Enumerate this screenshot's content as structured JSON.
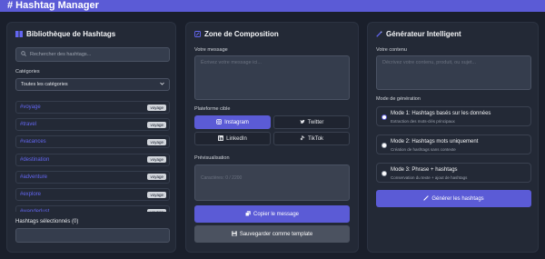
{
  "app": {
    "title": "# Hashtag Manager"
  },
  "library": {
    "title": "Bibliothèque de Hashtags",
    "search_placeholder": "Rechercher des hashtags...",
    "categories_label": "Catégories",
    "category_selected": "Toutes les catégories",
    "hashtags": [
      {
        "tag": "#voyage",
        "category": "voyage"
      },
      {
        "tag": "#travel",
        "category": "voyage"
      },
      {
        "tag": "#vacances",
        "category": "voyage"
      },
      {
        "tag": "#destination",
        "category": "voyage"
      },
      {
        "tag": "#adventure",
        "category": "voyage"
      },
      {
        "tag": "#explore",
        "category": "voyage"
      },
      {
        "tag": "#wanderlust",
        "category": "voyage"
      }
    ],
    "selected_label": "Hashtags sélectionnés (0)"
  },
  "composition": {
    "title": "Zone de Composition",
    "message_label": "Votre message",
    "message_placeholder": "Écrivez votre message ici...",
    "platform_label": "Plateforme cible",
    "platforms": [
      {
        "label": "Instagram",
        "icon": "instagram-icon",
        "active": true
      },
      {
        "label": "Twitter",
        "icon": "twitter-icon",
        "active": false
      },
      {
        "label": "LinkedIn",
        "icon": "linkedin-icon",
        "active": false
      },
      {
        "label": "TikTok",
        "icon": "tiktok-icon",
        "active": false
      }
    ],
    "preview_label": "Prévisualisation",
    "char_count": "Caractères: 0 / 2200",
    "copy_label": "Copier le message",
    "save_label": "Sauvegarder comme template"
  },
  "generator": {
    "title": "Générateur Intelligent",
    "content_label": "Votre contenu",
    "content_placeholder": "Décrivez votre contenu, produit, ou sujet...",
    "mode_label": "Mode de génération",
    "modes": [
      {
        "title": "Mode 1: Hashtags basés sur les données",
        "desc": "Extraction des mots-clés principaux",
        "selected": true
      },
      {
        "title": "Mode 2: Hashtags mots uniquement",
        "desc": "Création de hashtags sans contexte",
        "selected": false
      },
      {
        "title": "Mode 3: Phrase + hashtags",
        "desc": "Conservation du texte + ajout de hashtags",
        "selected": false
      }
    ],
    "generate_label": "Générer les hashtags"
  },
  "colors": {
    "accent": "#5b5bd6",
    "background": "#1a1f2b",
    "panel": "#232936",
    "hashtag": "#6366f1"
  }
}
